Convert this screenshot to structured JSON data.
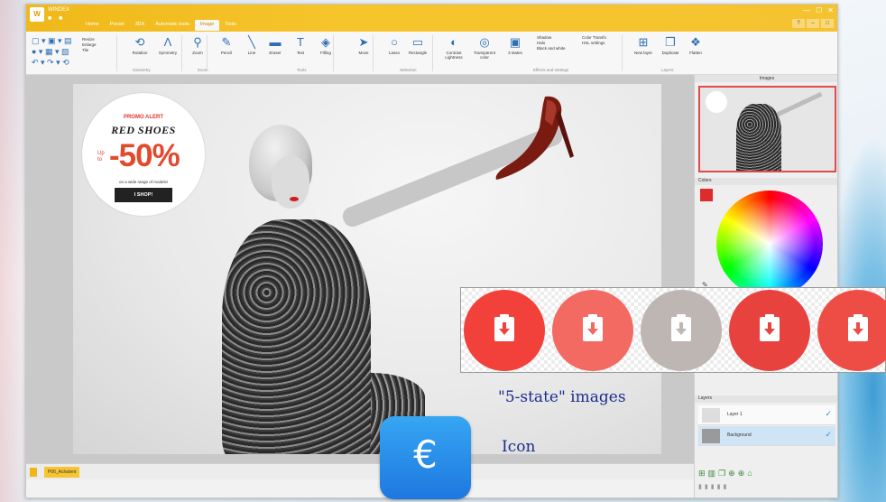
{
  "app": {
    "name": "WINDEX",
    "menu_tabs": [
      "Home",
      "Preset",
      "3DX",
      "Automatic tools",
      "Image",
      "Tools"
    ],
    "active_tab": "Image",
    "win_controls": [
      "—",
      "☐",
      "✕"
    ],
    "help_buttons": [
      "?",
      "–",
      "□"
    ]
  },
  "ribbon": {
    "left_list": [
      "Resize",
      "Enlarge",
      "Tile"
    ],
    "buttons": [
      {
        "label": "Rotation",
        "icon": "rotate-icon",
        "glyph": "⟲"
      },
      {
        "label": "Symmetry",
        "icon": "symmetry-icon",
        "glyph": "Λ"
      },
      {
        "label": "Zoom",
        "icon": "zoom-icon",
        "glyph": "⚲"
      },
      {
        "label": "Pencil",
        "icon": "pencil-icon",
        "glyph": "✎"
      },
      {
        "label": "Line",
        "icon": "line-icon",
        "glyph": "╲"
      },
      {
        "label": "Eraser",
        "icon": "eraser-icon",
        "glyph": "▬"
      },
      {
        "label": "Text",
        "icon": "text-icon",
        "glyph": "T"
      },
      {
        "label": "Filling",
        "icon": "bucket-icon",
        "glyph": "◈"
      },
      {
        "label": "Move",
        "icon": "move-icon",
        "glyph": "➤"
      },
      {
        "label": "Lasso",
        "icon": "lasso-icon",
        "glyph": "○"
      },
      {
        "label": "Rectangle",
        "icon": "rectangle-icon",
        "glyph": "▭"
      },
      {
        "label": "Contrast Lightness",
        "icon": "contrast-icon",
        "glyph": "◐"
      },
      {
        "label": "Transparent color",
        "icon": "transparent-icon",
        "glyph": "◎"
      },
      {
        "label": "3 states",
        "icon": "states-icon",
        "glyph": "▣"
      },
      {
        "label": "New layer",
        "icon": "new-layer-icon",
        "glyph": "⊞"
      },
      {
        "label": "Duplicate",
        "icon": "duplicate-icon",
        "glyph": "❐"
      },
      {
        "label": "Flatten",
        "icon": "flatten-icon",
        "glyph": "❖"
      }
    ],
    "effects_list": [
      "Shadow",
      "Halo",
      "Black and white"
    ],
    "effects_list2": [
      "Color Transfo",
      "HSL settings"
    ],
    "groups": [
      "Geometry",
      "Zoom",
      "Tools",
      "Selection",
      "Effects and settings",
      "Layers"
    ]
  },
  "promo": {
    "alert": "PROMO ALERT",
    "title": "RED SHOES",
    "up_to": "Up to",
    "percent": "-50%",
    "subtitle": "on a wide range of models!",
    "button": "I SHOP!"
  },
  "document_tab": "P06_Achatent",
  "right_panel": {
    "images_title": "Images",
    "colors_title": "Colors",
    "layers_title": "Layers",
    "selected_color": "#e02b2b",
    "layers": [
      {
        "name": "Layer 1",
        "selected": false
      },
      {
        "name": "Background",
        "selected": true
      }
    ],
    "check": "✓"
  },
  "states": {
    "colors": [
      "#f2413a",
      "#f26a62",
      "#bdb6b2",
      "#e8423f",
      "#ee4d45"
    ],
    "caption": "\"5-state\" images"
  },
  "icon_sample": {
    "glyph": "€",
    "caption": "Icon"
  }
}
